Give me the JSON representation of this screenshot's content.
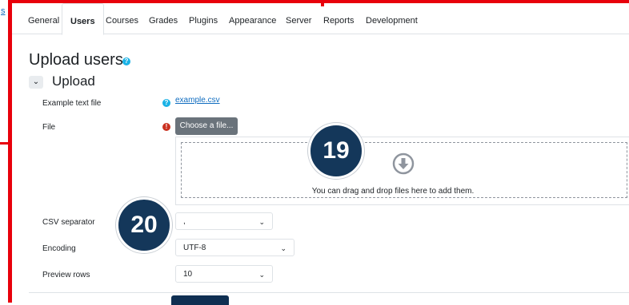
{
  "tabs": [
    {
      "label": "General"
    },
    {
      "label": "Users"
    },
    {
      "label": "Courses"
    },
    {
      "label": "Grades"
    },
    {
      "label": "Plugins"
    },
    {
      "label": "Appearance"
    },
    {
      "label": "Server"
    },
    {
      "label": "Reports"
    },
    {
      "label": "Development"
    }
  ],
  "page": {
    "title": "Upload users",
    "section": "Upload"
  },
  "form": {
    "example_label": "Example text file",
    "example_link": "example.csv",
    "file_label": "File",
    "choose_button": "Choose a file...",
    "drop_text": "You can drag and drop files here to add them.",
    "csv_label": "CSV separator",
    "csv_value": ",",
    "encoding_label": "Encoding",
    "encoding_value": "UTF-8",
    "preview_label": "Preview rows",
    "preview_value": "10"
  },
  "callouts": {
    "badge_19": "19",
    "badge_20": "20"
  },
  "icons": {
    "help": "?",
    "required": "!",
    "chevron": "⌄",
    "collapse": "⌄"
  },
  "left_glyph": "s",
  "colors": {
    "accent": "#0f6cbf",
    "frame": "#e8000b",
    "badge": "#14375a",
    "help": "#1ab2e6",
    "required": "#ca3120"
  }
}
